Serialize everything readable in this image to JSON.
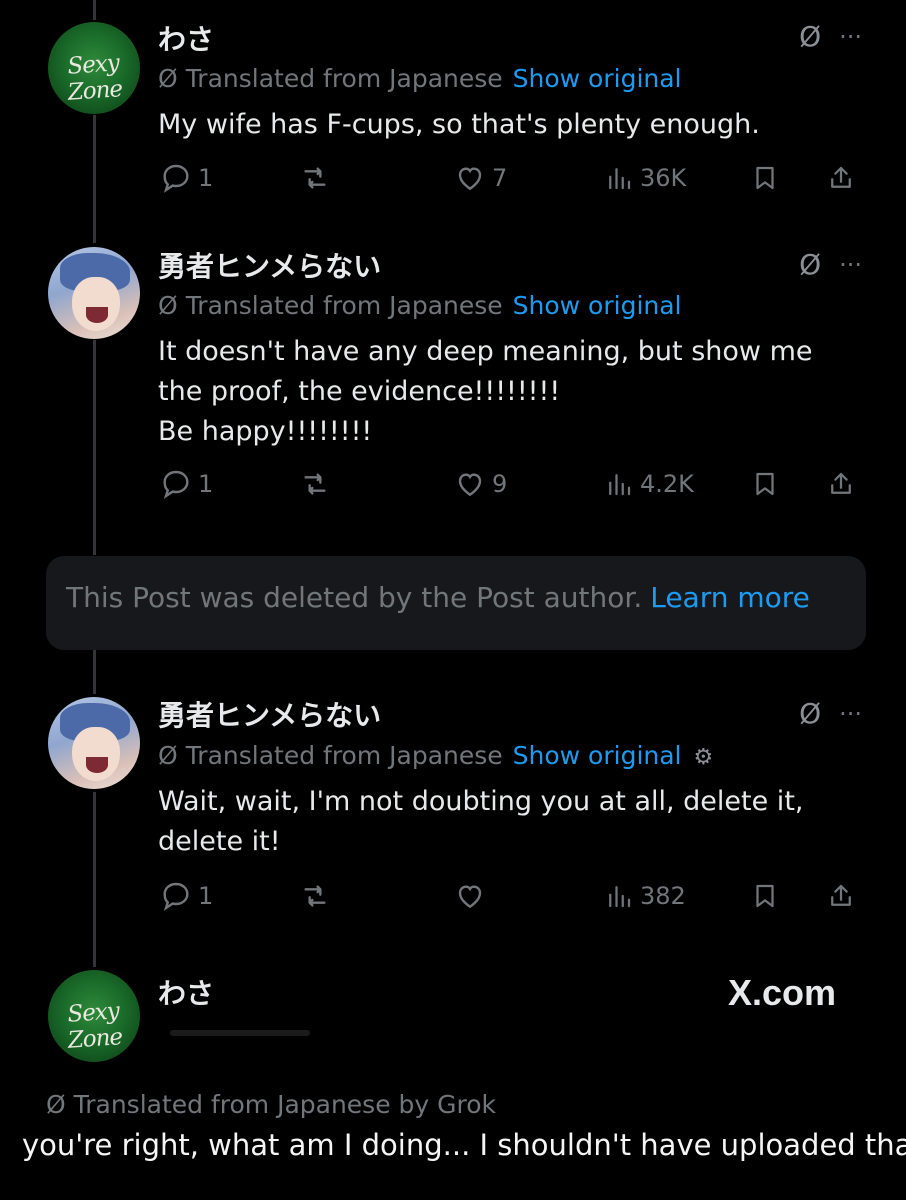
{
  "colors": {
    "background": "#000000",
    "text": "#e7e9ea",
    "muted": "#71767b",
    "link": "#1d9bf0"
  },
  "posts": [
    {
      "author": "わさ",
      "avatar_text": "Sexy Zone",
      "translated_label": "Translated from Japanese",
      "show_original": "Show original",
      "text": [
        "My wife has F-cups, so that's plenty enough."
      ],
      "metrics": {
        "replies": "1",
        "reposts": "",
        "likes": "7",
        "views": "36K"
      }
    },
    {
      "author": "勇者ヒンメらない",
      "translated_label": "Translated from Japanese",
      "show_original": "Show original",
      "text": [
        "It doesn't have any deep meaning, but show me",
        "the proof, the evidence!!!!!!!!",
        "Be happy!!!!!!!!"
      ],
      "metrics": {
        "replies": "1",
        "reposts": "",
        "likes": "9",
        "views": "4.2K"
      }
    },
    {
      "author": "勇者ヒンメらない",
      "translated_label": "Translated from Japanese",
      "show_original": "Show original",
      "text": [
        "Wait, wait, I'm not doubting you at all, delete it,",
        "delete it!"
      ],
      "metrics": {
        "replies": "1",
        "reposts": "",
        "likes": "",
        "views": "382"
      }
    },
    {
      "author": "わさ",
      "avatar_text": "Sexy Zone"
    }
  ],
  "deleted_notice": {
    "text": "This Post was deleted by the Post author.",
    "link": "Learn more"
  },
  "watermark": "X.com",
  "grok_translation": "Translated from Japanese by Grok",
  "caption": "you're right, what am I doing... I shouldn't have uploaded that",
  "icons": [
    "grok-icon",
    "more-icon",
    "reply-icon",
    "repost-icon",
    "like-icon",
    "views-icon",
    "bookmark-icon",
    "share-icon",
    "gear-icon"
  ]
}
